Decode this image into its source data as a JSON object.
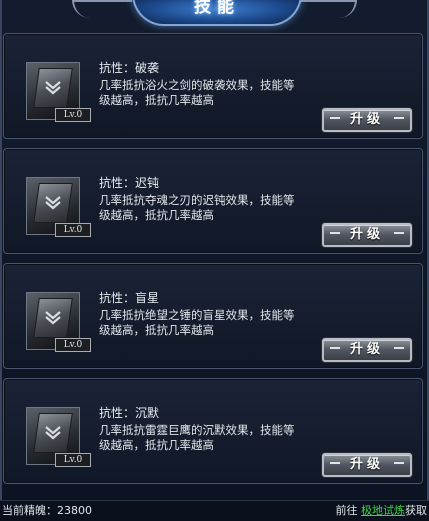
{
  "panel": {
    "title": "技能"
  },
  "skills": [
    {
      "attr_label": "抗性：",
      "name": "破袭",
      "level": "Lv.0",
      "description": "几率抵抗浴火之剑的破袭效果，技能等级越高，抵抗几率越高",
      "button_label": "升级"
    },
    {
      "attr_label": "抗性：",
      "name": "迟钝",
      "level": "Lv.0",
      "description": "几率抵抗夺魂之刃的迟钝效果，技能等级越高，抵抗几率越高",
      "button_label": "升级"
    },
    {
      "attr_label": "抗性：",
      "name": "盲星",
      "level": "Lv.0",
      "description": "几率抵抗绝望之锤的盲星效果，技能等级越高，抵抗几率越高",
      "button_label": "升级"
    },
    {
      "attr_label": "抗性：",
      "name": "沉默",
      "level": "Lv.0",
      "description": "几率抵抗雷霆巨鹰的沉默效果，技能等级越高，抵抗几率越高",
      "button_label": "升级"
    }
  ],
  "footer": {
    "essence_label": "当前精魄：",
    "essence_value": "23800",
    "goto_prefix": "前往",
    "goto_link": "极地试炼",
    "goto_suffix": "获取"
  }
}
